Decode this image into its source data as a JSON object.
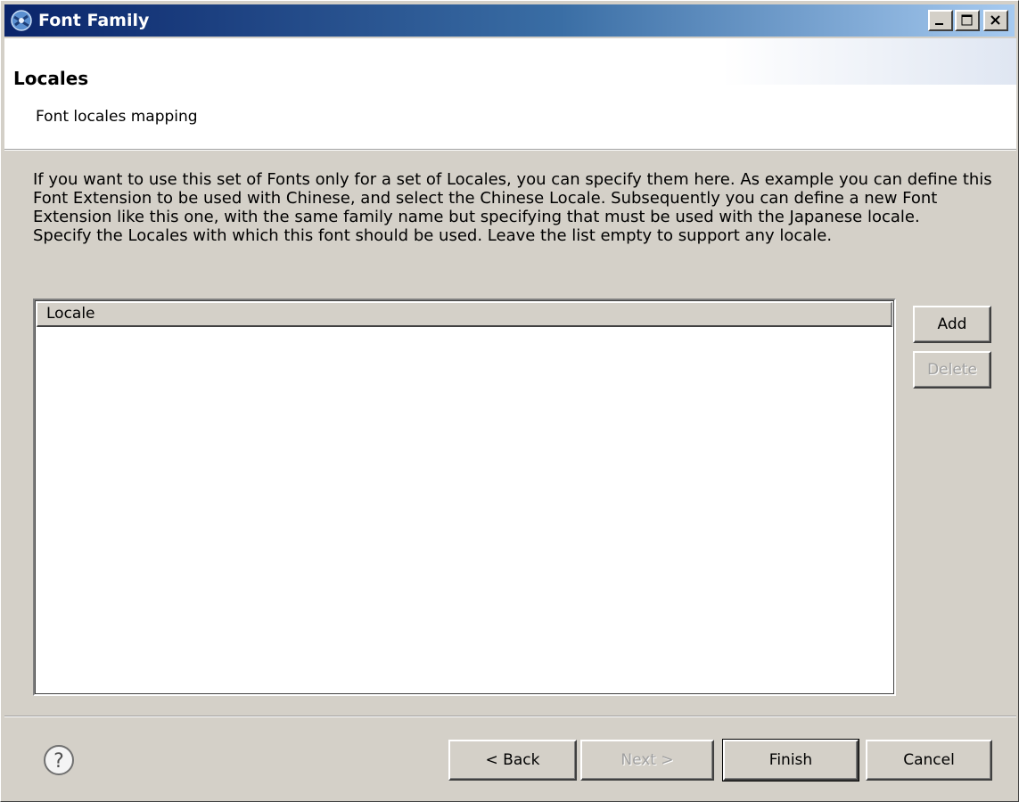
{
  "window": {
    "title": "Font Family",
    "app_icon": "eclipse-icon",
    "controls": {
      "minimize_icon": "minimize-icon",
      "maximize_icon": "maximize-icon",
      "close_icon": "close-icon"
    }
  },
  "header": {
    "title": "Locales",
    "subtitle": "Font locales mapping"
  },
  "description": {
    "paragraph": "If you want to use this set of Fonts only for a set of Locales, you can specify them here. As example you can define this Font Extension to be used with Chinese, and select the Chinese Locale. Subsequently you can define a new Font Extension like this one, with the same family name but specifying that must be used with the Japanese locale.",
    "instruction": "Specify the Locales with which this font should be used. Leave the list empty to support any locale."
  },
  "locale_table": {
    "columns": [
      "Locale"
    ],
    "rows": []
  },
  "side_buttons": {
    "add_label": "Add",
    "delete_label": "Delete"
  },
  "footer": {
    "help_icon": "help-icon",
    "back_label": "< Back",
    "next_label": "Next >",
    "finish_label": "Finish",
    "cancel_label": "Cancel"
  }
}
